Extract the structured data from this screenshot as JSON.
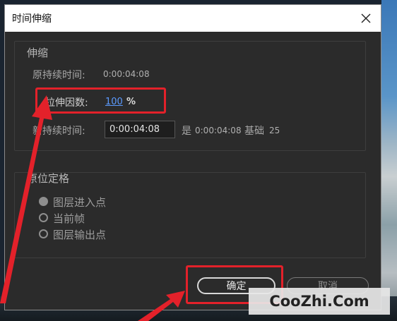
{
  "dialog": {
    "title": "时间伸缩"
  },
  "stretch": {
    "group_title": "伸缩",
    "original_duration_label": "原持续时间:",
    "original_duration_value": "0:00:04:08",
    "factor_label": "拉伸因数:",
    "factor_value": "100",
    "factor_unit": "%",
    "new_duration_label": "新持续时间:",
    "new_duration_value": "0:00:04:08",
    "equals_label": "是",
    "equals_value": "0:00:04:08",
    "base_label": "基础",
    "base_value": "25"
  },
  "hold": {
    "group_title": "原位定格",
    "options": [
      {
        "label": "图层进入点",
        "selected": true
      },
      {
        "label": "当前帧",
        "selected": false
      },
      {
        "label": "图层输出点",
        "selected": false
      }
    ]
  },
  "buttons": {
    "ok_label": "确定",
    "cancel_label": "取消"
  },
  "overlay": {
    "highlight_color": "#e3212a",
    "watermark": "CooZhi.Com"
  }
}
